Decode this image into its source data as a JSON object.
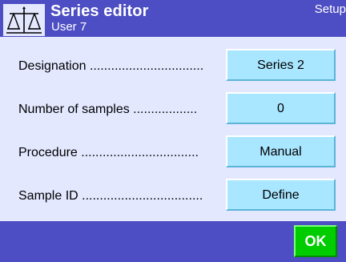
{
  "header": {
    "icon": "balance-scale-icon",
    "title": "Series editor",
    "user": "User 7",
    "section": "Setup"
  },
  "rows": [
    {
      "label": "Designation ................................",
      "value": "Series 2"
    },
    {
      "label": "Number of samples ..................",
      "value": "0"
    },
    {
      "label": "Procedure .................................",
      "value": "Manual"
    },
    {
      "label": "Sample ID ..................................",
      "value": "Define"
    }
  ],
  "footer": {
    "ok_label": "OK"
  },
  "colors": {
    "header_bg": "#4d4dc4",
    "content_bg": "#e3e8ff",
    "field_bg": "#a9e6ff",
    "ok_bg": "#00cc00"
  }
}
